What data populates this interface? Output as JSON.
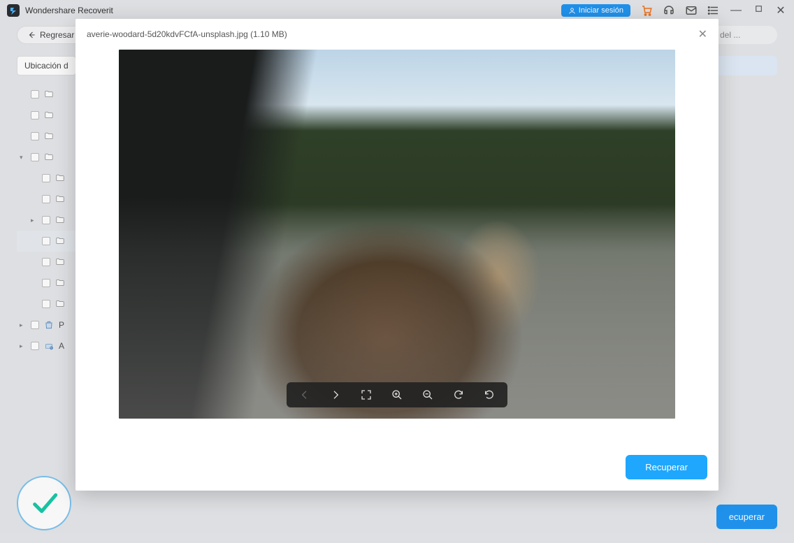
{
  "app": {
    "title": "Wondershare Recoverit",
    "login_label": "Iniciar sesión"
  },
  "toolbar": {
    "back_label": "Regresar",
    "search_placeholder": "re del ..."
  },
  "sidebar": {
    "location_label": "Ubicación d",
    "items": [
      {
        "type": "folder",
        "label": "",
        "indent": 0,
        "expander": ""
      },
      {
        "type": "folder",
        "label": "",
        "indent": 0,
        "expander": ""
      },
      {
        "type": "folder",
        "label": "",
        "indent": 0,
        "expander": ""
      },
      {
        "type": "folder",
        "label": "",
        "indent": 0,
        "expander": "▾"
      },
      {
        "type": "folder",
        "label": "",
        "indent": 1,
        "expander": ""
      },
      {
        "type": "folder",
        "label": "",
        "indent": 1,
        "expander": ""
      },
      {
        "type": "folder",
        "label": "",
        "indent": 1,
        "expander": "▸"
      },
      {
        "type": "folder",
        "label": "",
        "indent": 1,
        "expander": "",
        "selected": true
      },
      {
        "type": "folder",
        "label": "",
        "indent": 1,
        "expander": ""
      },
      {
        "type": "folder",
        "label": "",
        "indent": 1,
        "expander": ""
      },
      {
        "type": "folder",
        "label": "",
        "indent": 1,
        "expander": ""
      },
      {
        "type": "trash",
        "label": "P",
        "indent": 0,
        "expander": "▸"
      },
      {
        "type": "ext",
        "label": "A",
        "indent": 0,
        "expander": "▸"
      }
    ]
  },
  "modal": {
    "filename": "averie-woodard-5d20kdvFCfA-unsplash.jpg (1.10 MB)",
    "recover_label": "Recuperar"
  },
  "bottom": {
    "recover_label": "ecuperar"
  },
  "colors": {
    "accent": "#1ea7fd",
    "accent_dark": "#2196f3"
  }
}
